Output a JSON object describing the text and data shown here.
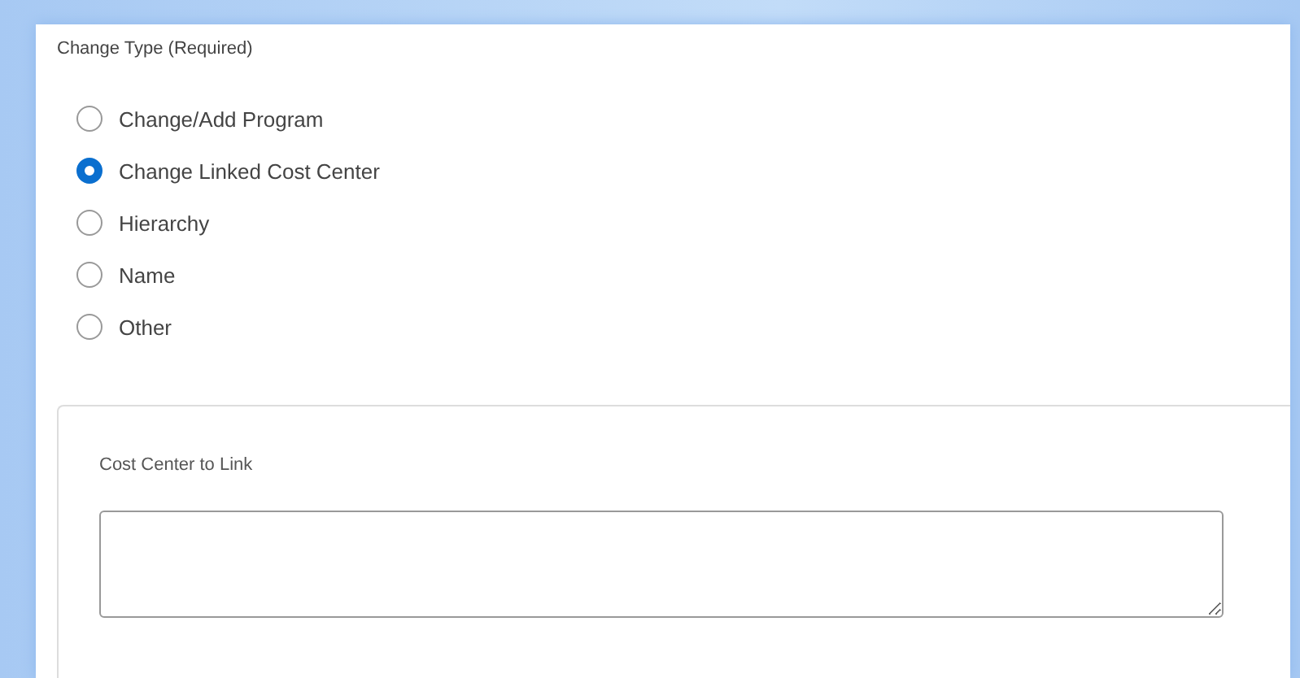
{
  "change_type": {
    "label": "Change Type (Required)",
    "options": [
      {
        "label": "Change/Add Program",
        "selected": false
      },
      {
        "label": "Change Linked Cost Center",
        "selected": true
      },
      {
        "label": "Hierarchy",
        "selected": false
      },
      {
        "label": "Name",
        "selected": false
      },
      {
        "label": "Other",
        "selected": false
      }
    ]
  },
  "cost_center": {
    "label": "Cost Center to Link"
  }
}
